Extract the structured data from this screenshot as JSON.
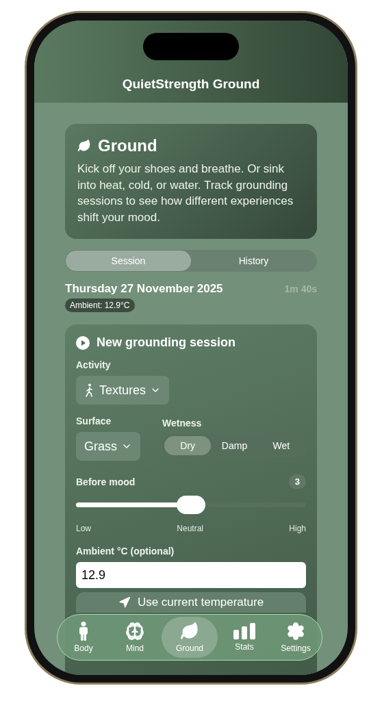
{
  "header": {
    "title": "QuietStrength Ground"
  },
  "intro": {
    "title": "Ground",
    "text": "Kick off your shoes and breathe. Or sink into heat, cold, or water. Track grounding sessions to see how different experiences shift your mood."
  },
  "tabs": [
    {
      "label": "Session",
      "selected": true
    },
    {
      "label": "History",
      "selected": false
    }
  ],
  "date": "Thursday 27 November 2025",
  "elapsed": "1m 40s",
  "ambient_badge": "Ambient: 12.9°C",
  "session_card": {
    "title": "New grounding session",
    "activity": {
      "label": "Activity",
      "value": "Textures"
    },
    "surface": {
      "label": "Surface",
      "value": "Grass"
    },
    "wetness": {
      "label": "Wetness",
      "options": [
        {
          "label": "Dry",
          "selected": true
        },
        {
          "label": "Damp",
          "selected": false
        },
        {
          "label": "Wet",
          "selected": false
        }
      ]
    },
    "mood": {
      "label": "Before mood",
      "value": "3",
      "level": 0.5,
      "scale": [
        "Low",
        "Neutral",
        "High"
      ]
    },
    "ambient": {
      "label": "Ambient °C (optional)",
      "value": "12.9"
    },
    "temperature_button": "Use current temperature"
  },
  "nav": [
    {
      "kind": "body",
      "label": "Body",
      "selected": false
    },
    {
      "kind": "mind",
      "label": "Mind",
      "selected": false
    },
    {
      "kind": "ground",
      "label": "Ground",
      "selected": true
    },
    {
      "kind": "stats",
      "label": "Stats",
      "selected": false
    },
    {
      "kind": "settings",
      "label": "Settings",
      "selected": false
    }
  ]
}
